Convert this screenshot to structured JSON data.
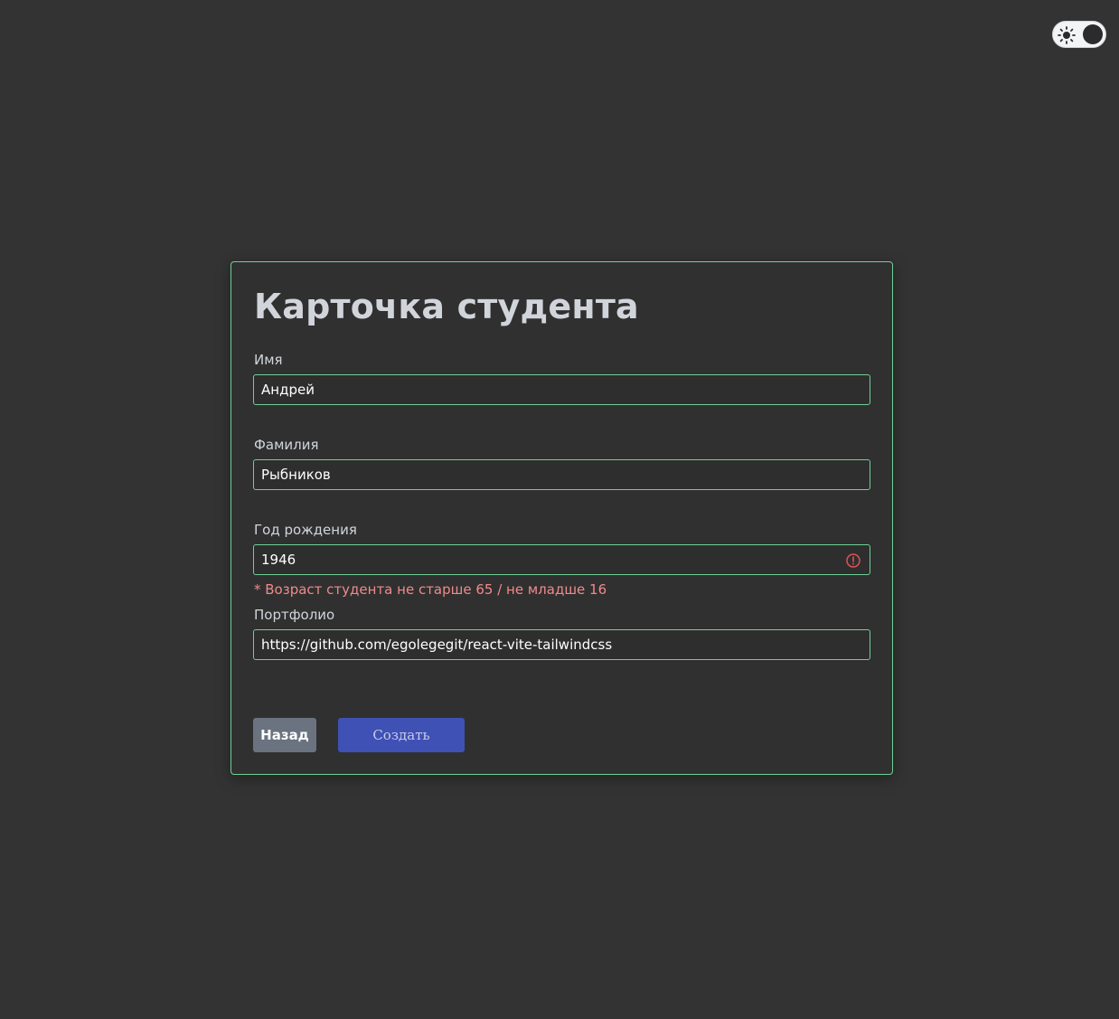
{
  "theme_toggle": {
    "icon": "sun-icon",
    "state": "dark"
  },
  "card": {
    "title": "Карточка студента",
    "fields": [
      {
        "label": "Имя",
        "value": "Андрей"
      },
      {
        "label": "Фамилия",
        "value": "Рыбников"
      },
      {
        "label": "Год рождения",
        "value": "1946",
        "error": "* Возраст студента не старше 65 / не младше 16"
      },
      {
        "label": "Портфолио",
        "value": "https://github.com/egolegegit/react-vite-tailwindcss"
      }
    ],
    "buttons": {
      "back_label": "Назад",
      "create_label": "Создать"
    }
  },
  "colors": {
    "background": "#333333",
    "card_border": "#6fcf97",
    "error": "#f08a8a",
    "primary": "#3f51b5",
    "secondary": "#6b7280"
  }
}
